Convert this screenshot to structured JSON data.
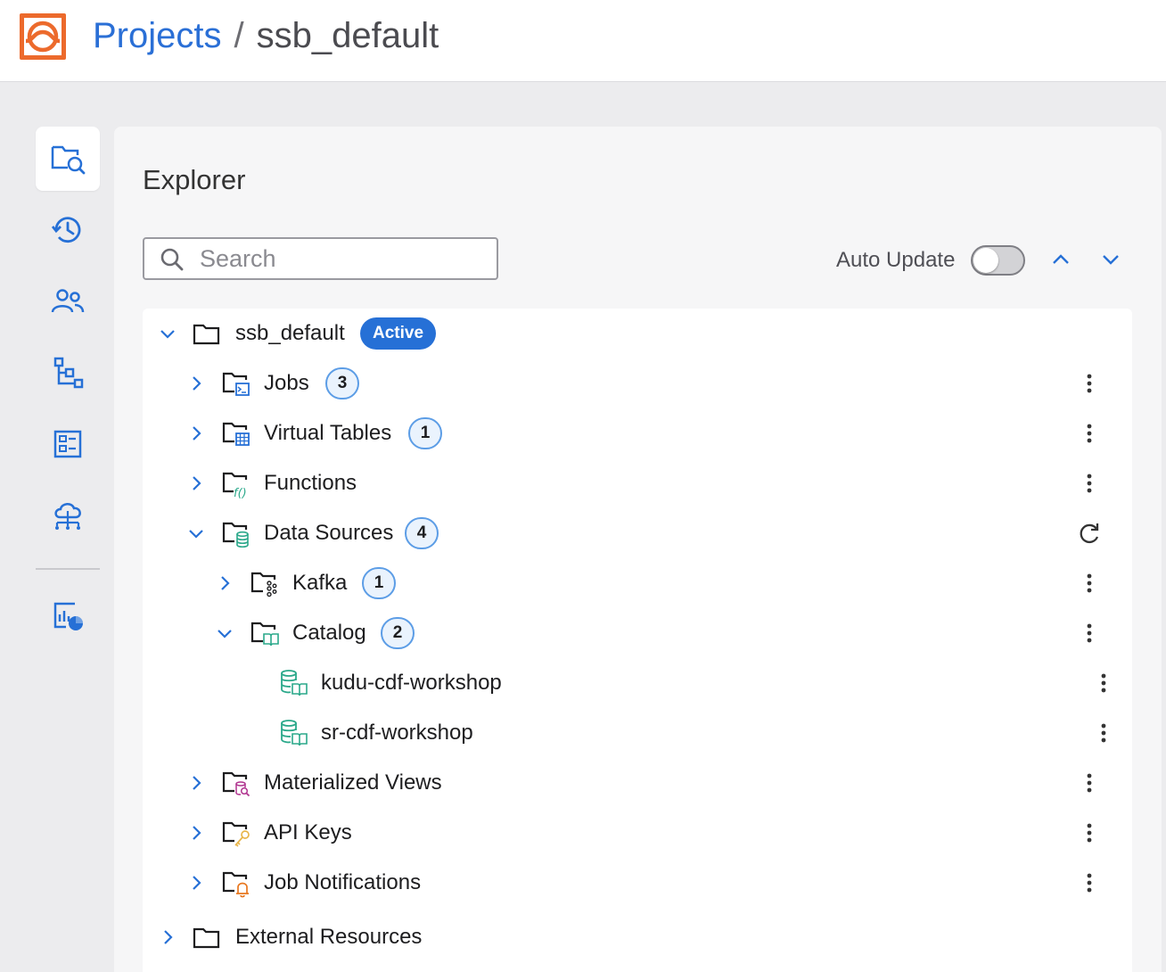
{
  "header": {
    "logo": "ssb-logo",
    "breadcrumb_root": "Projects",
    "breadcrumb_separator": "/",
    "breadcrumb_current": "ssb_default"
  },
  "rail": {
    "items": [
      {
        "icon": "folder-search-icon",
        "active": true
      },
      {
        "icon": "history-icon"
      },
      {
        "icon": "users-icon"
      },
      {
        "icon": "hierarchy-icon"
      },
      {
        "icon": "dashboard-icon"
      },
      {
        "icon": "cloud-network-icon"
      },
      {
        "icon": "report-chart-icon"
      }
    ]
  },
  "explorer": {
    "title": "Explorer",
    "search": {
      "placeholder": "Search",
      "value": ""
    },
    "auto_update_label": "Auto Update",
    "auto_update_on": false,
    "tree": {
      "root": {
        "label": "ssb_default",
        "badge": "Active",
        "expanded": true
      },
      "jobs": {
        "label": "Jobs",
        "count": "3"
      },
      "virtual_tables": {
        "label": "Virtual Tables",
        "count": "1"
      },
      "functions": {
        "label": "Functions"
      },
      "data_sources": {
        "label": "Data Sources",
        "count": "4",
        "expanded": true
      },
      "kafka": {
        "label": "Kafka",
        "count": "1"
      },
      "catalog": {
        "label": "Catalog",
        "count": "2",
        "expanded": true
      },
      "catalog_items": [
        "kudu-cdf-workshop",
        "sr-cdf-workshop"
      ],
      "materialized_views": {
        "label": "Materialized Views"
      },
      "api_keys": {
        "label": "API Keys"
      },
      "job_notifications": {
        "label": "Job Notifications"
      },
      "external_resources": {
        "label": "External Resources"
      }
    }
  },
  "colors": {
    "accent": "#2670d6",
    "logo_orange": "#ec6a2c",
    "teal_icon": "#2aa88a",
    "purple_icon": "#b0348f",
    "key_icon": "#e8b54a",
    "bell_icon": "#e8771f"
  }
}
